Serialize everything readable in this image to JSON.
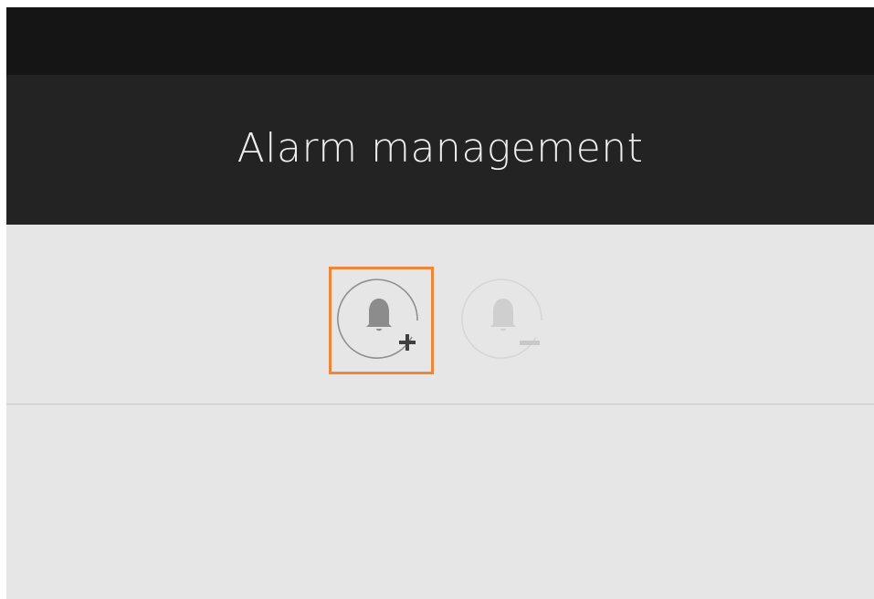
{
  "header": {
    "title": "Alarm management"
  },
  "toolbar": {
    "add_alarm": {
      "icon": "bell-add-icon",
      "enabled": true,
      "highlighted": true
    },
    "remove_alarm": {
      "icon": "bell-remove-icon",
      "enabled": false
    }
  },
  "colors": {
    "status_bar": "#151515",
    "header_bg": "#232323",
    "content_bg": "#e6e6e6",
    "highlight": "#ef8535"
  }
}
